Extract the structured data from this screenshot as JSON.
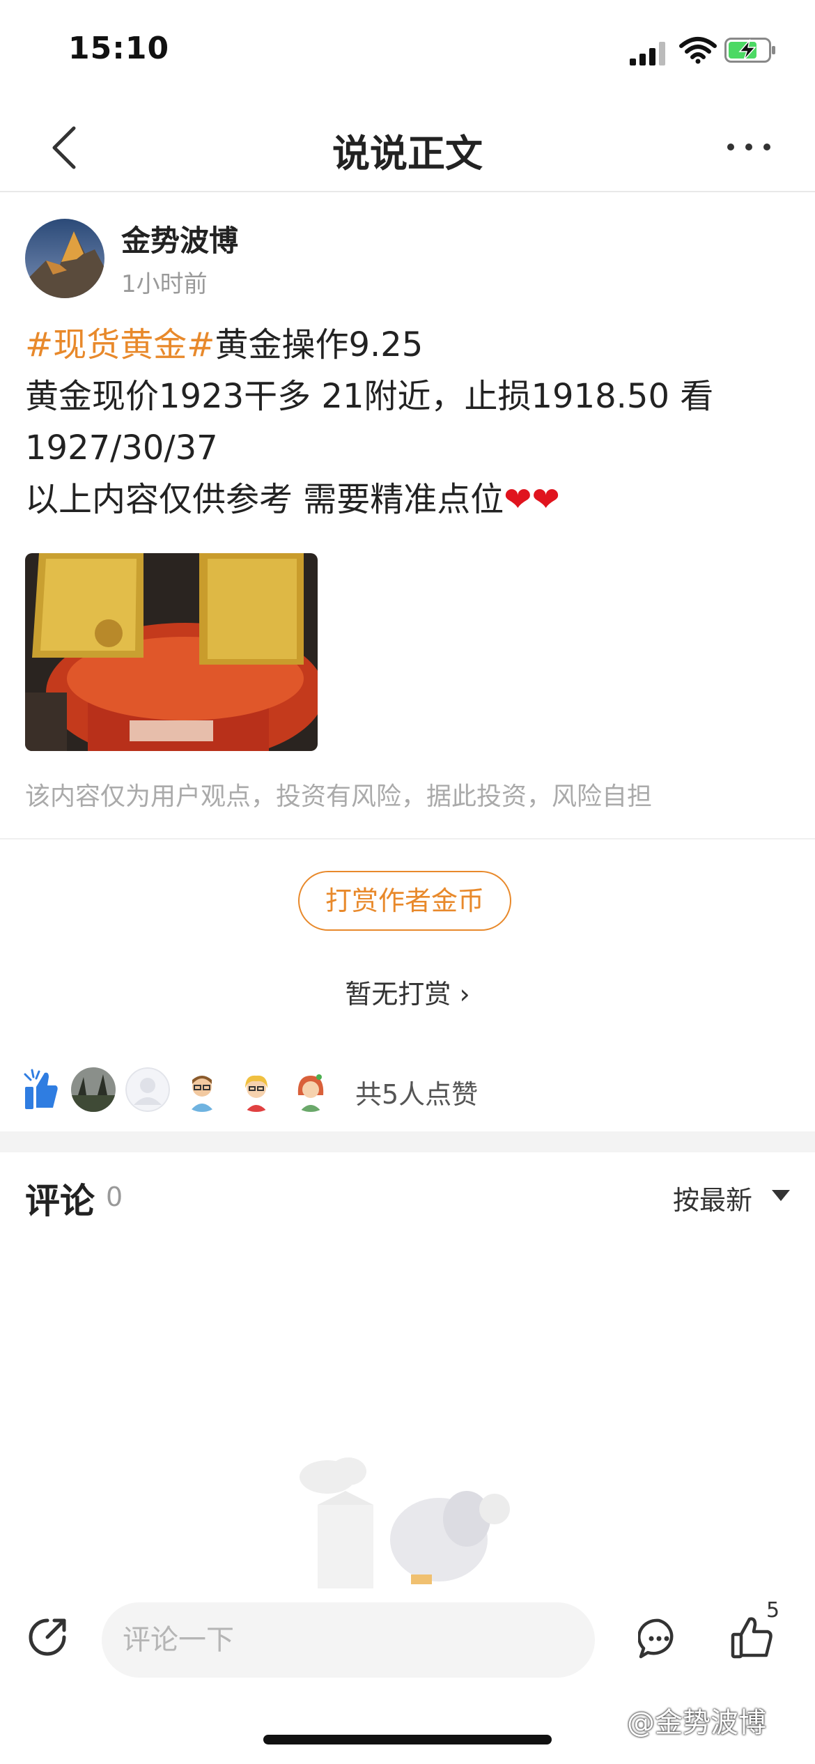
{
  "status_bar": {
    "time": "15:10"
  },
  "nav": {
    "title": "说说正文"
  },
  "author": {
    "name": "金势波博",
    "time": "1小时前"
  },
  "post": {
    "hashtag": "#现货黄金#",
    "line1_rest": "黄金操作9.25",
    "line2": "黄金现价1923干多 21附近，止损1918.50 看",
    "line3": "1927/30/37",
    "line4_text": "以上内容仅供参考 需要精准点位",
    "hearts": "❤❤"
  },
  "disclaimer": "该内容仅为用户观点，投资有风险，据此投资，风险自担",
  "reward": {
    "button": "打赏作者金币",
    "status": "暂无打赏 ›"
  },
  "likes": {
    "count_text": "共5人点赞"
  },
  "comments": {
    "title": "评论",
    "count": "0",
    "sort": "按最新"
  },
  "bottom_bar": {
    "input_placeholder": "评论一下",
    "like_count": "5"
  },
  "watermark": "@金势波博",
  "colors": {
    "accent": "#e8892b",
    "heart": "#e0141e",
    "like_blue": "#2f7de1"
  },
  "icons": [
    "back-icon",
    "more-icon",
    "share-icon",
    "comment-icon",
    "thumbs-up-icon",
    "wifi-icon",
    "battery-icon",
    "signal-icon"
  ]
}
